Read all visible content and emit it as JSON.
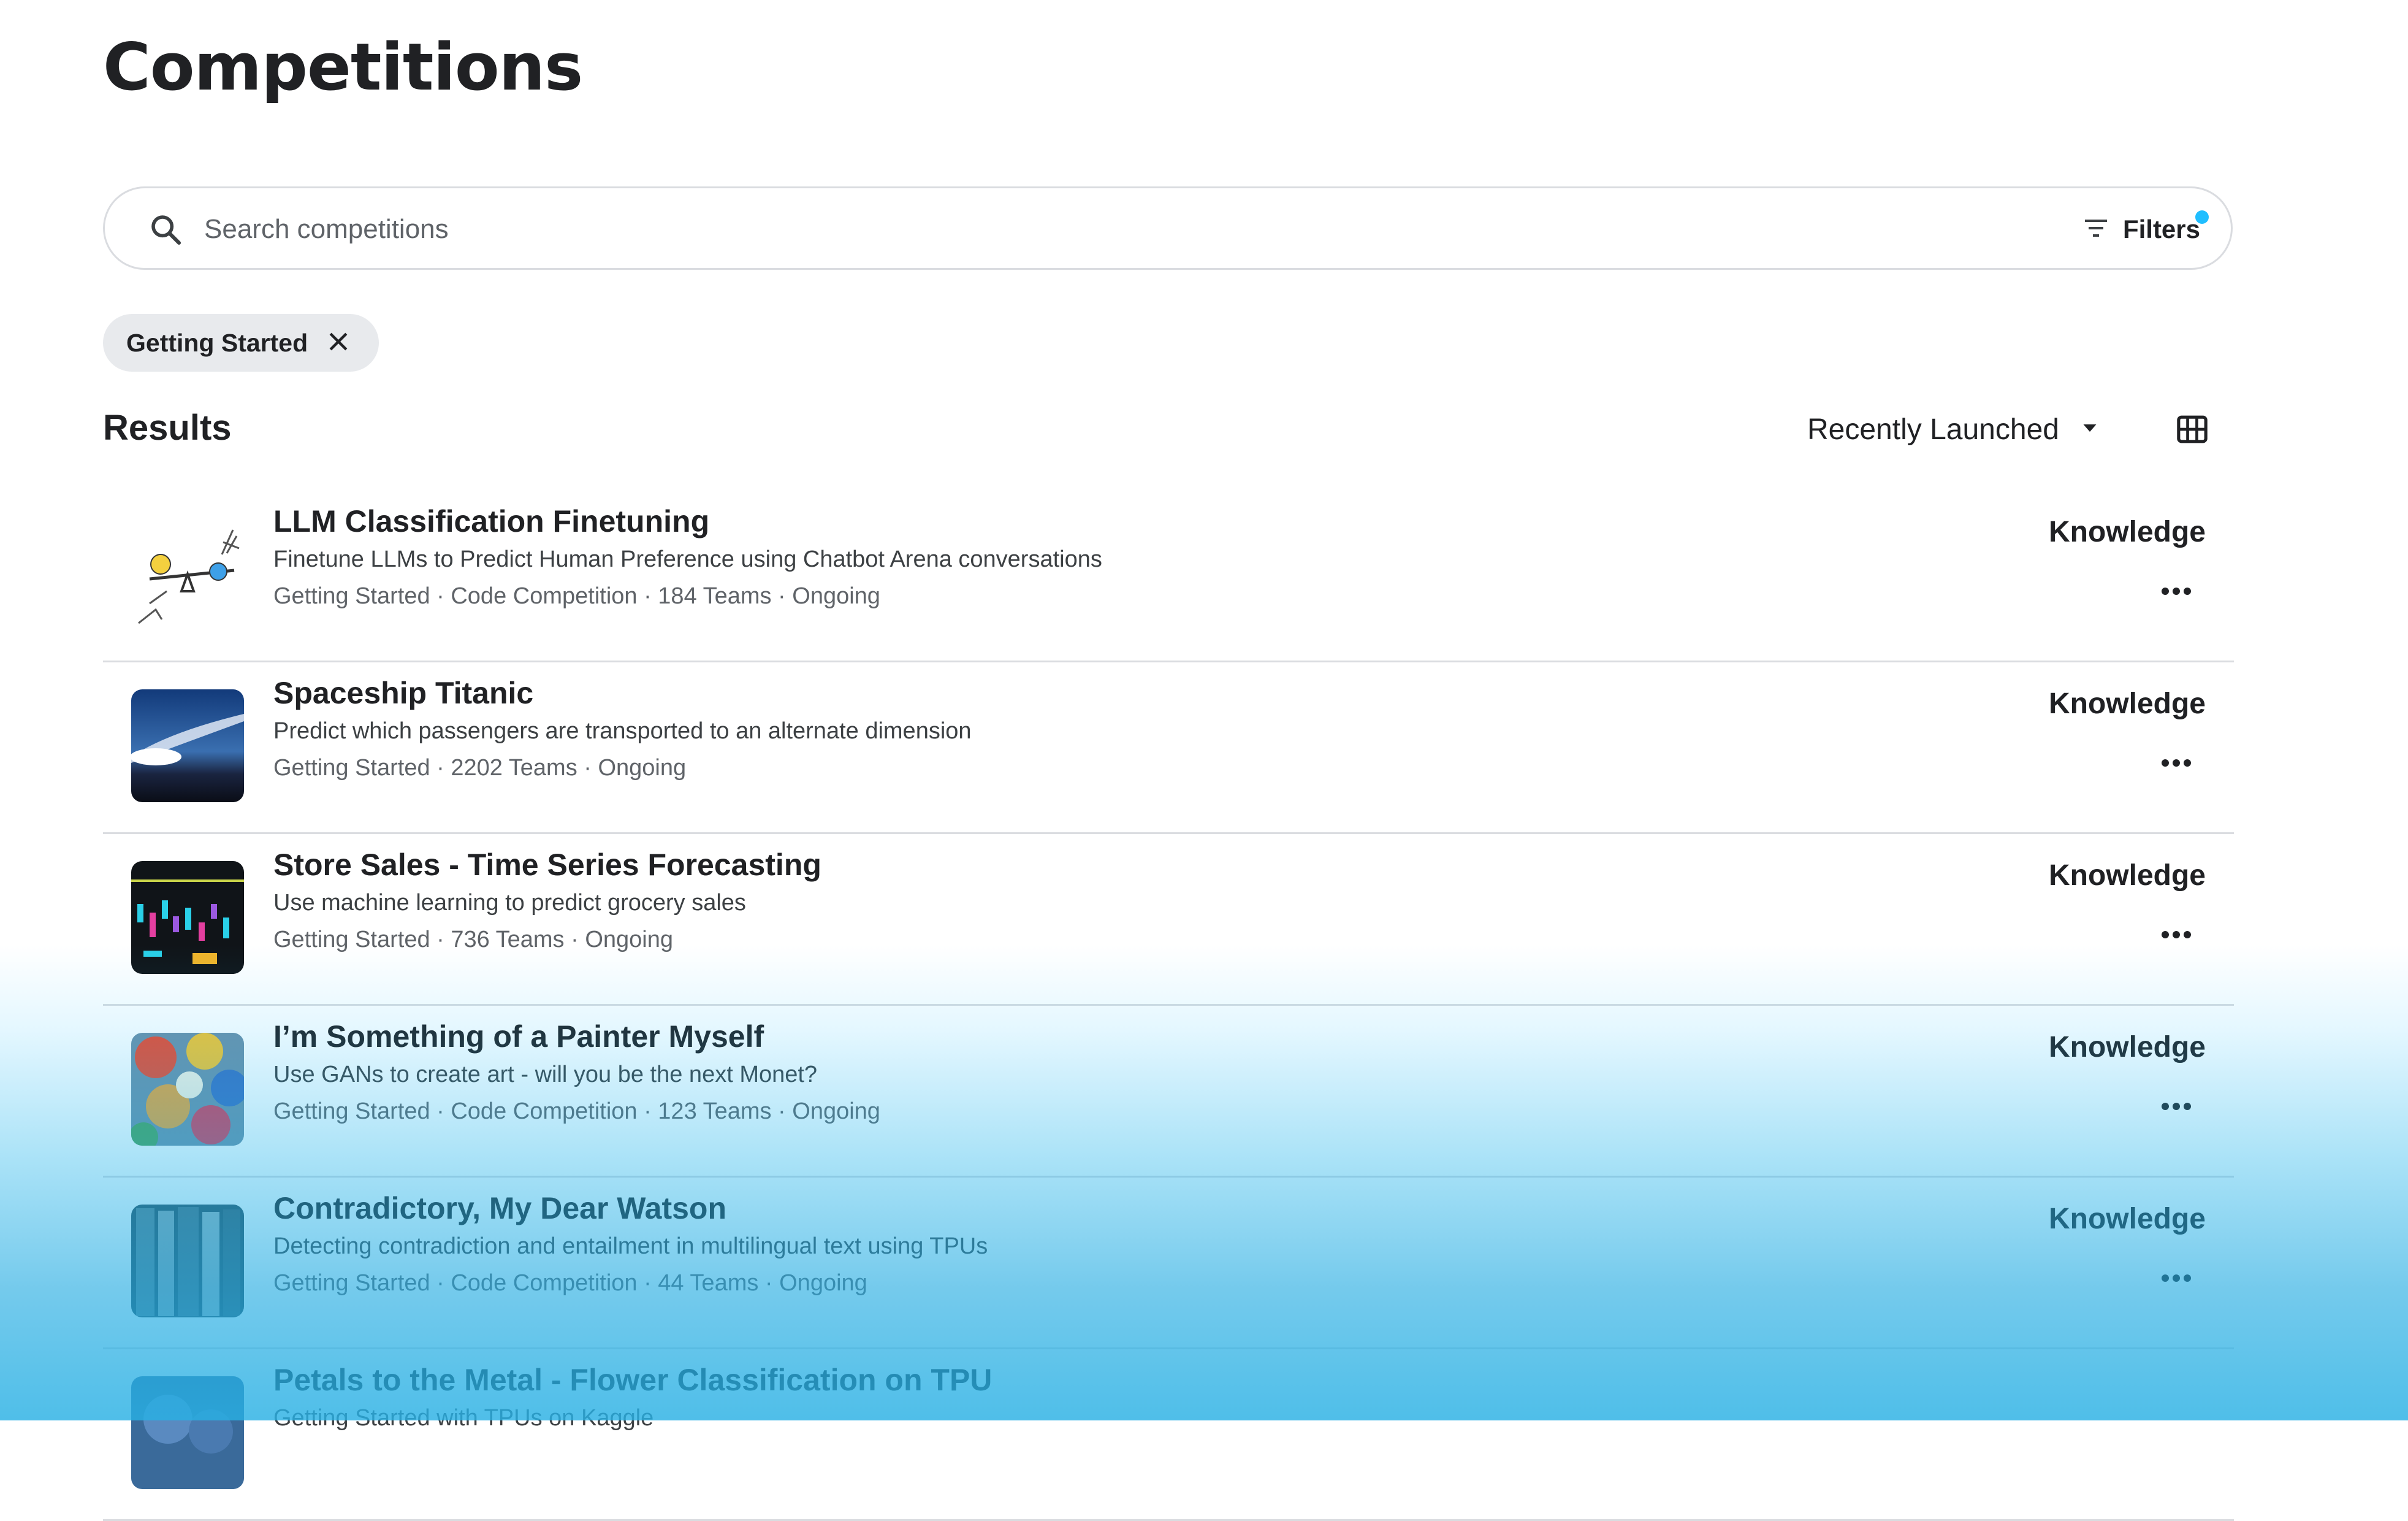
{
  "page": {
    "title": "Competitions"
  },
  "search": {
    "placeholder": "Search competitions",
    "filters_label": "Filters"
  },
  "active_filter": {
    "label": "Getting Started"
  },
  "results": {
    "title": "Results",
    "sort_label": "Recently Launched",
    "view_icon": "grid-icon"
  },
  "competitions": [
    {
      "title": "LLM Classification Finetuning",
      "description": "Finetune LLMs to Predict Human Preference using Chatbot Arena conversations",
      "meta": "Getting Started · Code Competition · 184 Teams · Ongoing",
      "tier": "Knowledge",
      "thumb": "seesaw-illustration"
    },
    {
      "title": "Spaceship Titanic",
      "description": "Predict which passengers are transported to an alternate dimension",
      "meta": "Getting Started · 2202 Teams · Ongoing",
      "tier": "Knowledge",
      "thumb": "spaceship-photo"
    },
    {
      "title": "Store Sales - Time Series Forecasting",
      "description": "Use machine learning to predict grocery sales",
      "meta": "Getting Started · 736 Teams · Ongoing",
      "tier": "Knowledge",
      "thumb": "sales-chart-photo"
    },
    {
      "title": "I’m Something of a Painter Myself",
      "description": "Use GANs to create art - will you be the next Monet?",
      "meta": "Getting Started · Code Competition · 123 Teams · Ongoing",
      "tier": "Knowledge",
      "thumb": "paint-palette-photo"
    },
    {
      "title": "Contradictory, My Dear Watson",
      "description": "Detecting contradiction and entailment in multilingual text using TPUs",
      "meta": "Getting Started · Code Competition · 44 Teams · Ongoing",
      "tier": "Knowledge",
      "thumb": "books-photo"
    },
    {
      "title": "Petals to the Metal - Flower Classification on TPU",
      "description": "",
      "meta": "Getting Started with TPUs on Kaggle",
      "tier": "",
      "thumb": "flowers-photo"
    }
  ],
  "colors": {
    "accent": "#20beff",
    "text": "#202124",
    "divider": "#dadce0",
    "chip_bg": "#e8eaed"
  }
}
